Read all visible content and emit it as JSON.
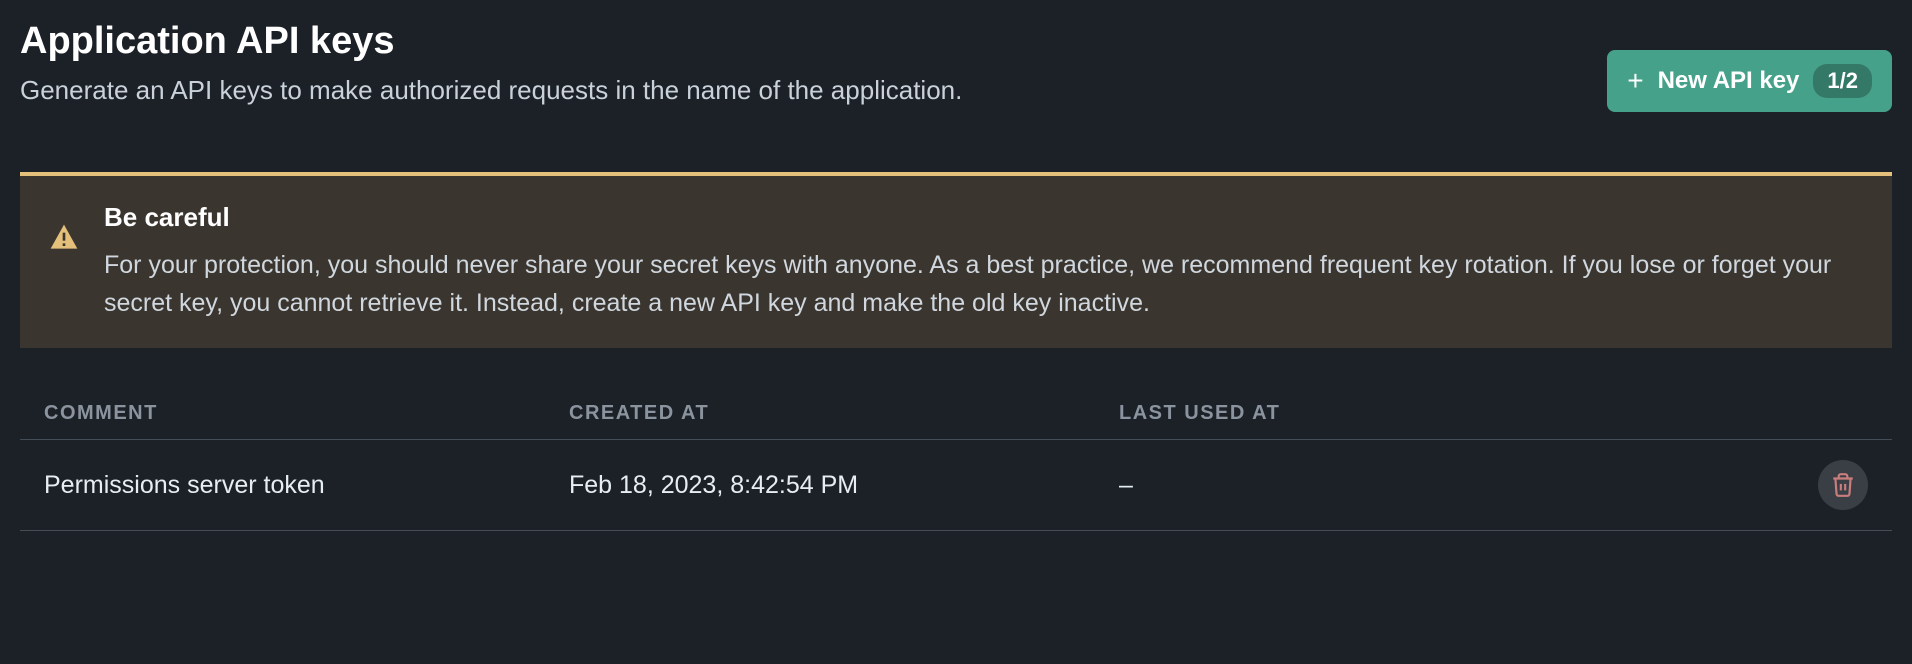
{
  "header": {
    "title": "Application API keys",
    "subtitle": "Generate an API keys to make authorized requests in the name of the application."
  },
  "newKeyButton": {
    "label": "New API key",
    "badge": "1/2"
  },
  "warning": {
    "title": "Be careful",
    "text": "For your protection, you should never share your secret keys with anyone. As a best practice, we recommend frequent key rotation. If you lose or forget your secret key, you cannot retrieve it. Instead, create a new API key and make the old key inactive."
  },
  "table": {
    "headers": {
      "comment": "COMMENT",
      "createdAt": "CREATED AT",
      "lastUsedAt": "LAST USED AT"
    },
    "rows": [
      {
        "comment": "Permissions server token",
        "createdAt": "Feb 18, 2023, 8:42:54 PM",
        "lastUsedAt": "–"
      }
    ]
  }
}
